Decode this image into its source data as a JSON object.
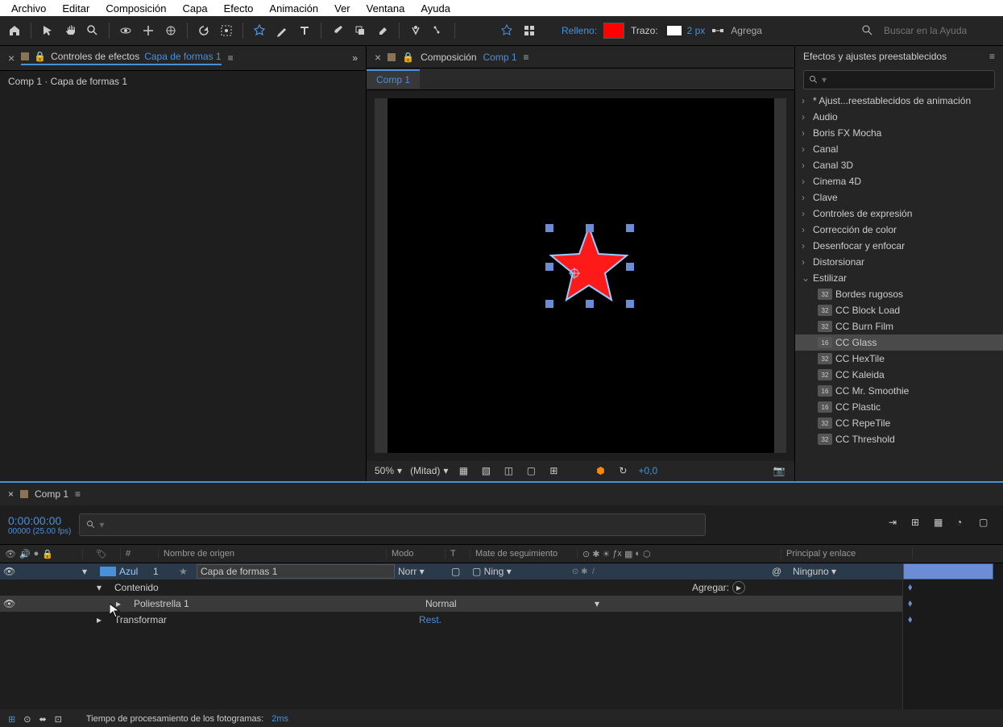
{
  "menu": {
    "items": [
      "Archivo",
      "Editar",
      "Composición",
      "Capa",
      "Efecto",
      "Animación",
      "Ver",
      "Ventana",
      "Ayuda"
    ]
  },
  "toolbar": {
    "fill_label": "Relleno:",
    "stroke_label": "Trazo:",
    "stroke_px": "2 px",
    "add_label": "Agrega",
    "help_placeholder": "Buscar en la Ayuda"
  },
  "left_panel": {
    "title": "Controles de efectos",
    "layer": "Capa de formas 1",
    "breadcrumb": "Comp 1 · Capa de formas 1"
  },
  "center_panel": {
    "title": "Composición",
    "comp": "Comp 1",
    "tab": "Comp 1"
  },
  "viewer_controls": {
    "zoom": "50%",
    "res": "(Mitad)",
    "offset": "+0,0"
  },
  "right_panel": {
    "title": "Efectos y ajustes preestablecidos",
    "tree": [
      {
        "label": "* Ajust...reestablecidos de animación",
        "open": false,
        "lvl": 0
      },
      {
        "label": "Audio",
        "open": false,
        "lvl": 0
      },
      {
        "label": "Boris FX Mocha",
        "open": false,
        "lvl": 0
      },
      {
        "label": "Canal",
        "open": false,
        "lvl": 0
      },
      {
        "label": "Canal 3D",
        "open": false,
        "lvl": 0
      },
      {
        "label": "Cinema 4D",
        "open": false,
        "lvl": 0
      },
      {
        "label": "Clave",
        "open": false,
        "lvl": 0
      },
      {
        "label": "Controles de expresión",
        "open": false,
        "lvl": 0
      },
      {
        "label": "Corrección de color",
        "open": false,
        "lvl": 0
      },
      {
        "label": "Desenfocar y enfocar",
        "open": false,
        "lvl": 0
      },
      {
        "label": "Distorsionar",
        "open": false,
        "lvl": 0
      },
      {
        "label": "Estilizar",
        "open": true,
        "lvl": 0
      },
      {
        "label": "Bordes rugosos",
        "lvl": 1,
        "badge": "32"
      },
      {
        "label": "CC Block Load",
        "lvl": 1,
        "badge": "32"
      },
      {
        "label": "CC Burn Film",
        "lvl": 1,
        "badge": "32"
      },
      {
        "label": "CC Glass",
        "lvl": 1,
        "badge": "16",
        "sel": true
      },
      {
        "label": "CC HexTile",
        "lvl": 1,
        "badge": "32"
      },
      {
        "label": "CC Kaleida",
        "lvl": 1,
        "badge": "32"
      },
      {
        "label": "CC Mr. Smoothie",
        "lvl": 1,
        "badge": "16"
      },
      {
        "label": "CC Plastic",
        "lvl": 1,
        "badge": "16"
      },
      {
        "label": "CC RepeTile",
        "lvl": 1,
        "badge": "32"
      },
      {
        "label": "CC Threshold",
        "lvl": 1,
        "badge": "32"
      }
    ]
  },
  "timeline": {
    "tab": "Comp 1",
    "time": "0:00:00:00",
    "fps": "00000 (25.00 fps)",
    "cols": {
      "num": "#",
      "source": "Nombre de origen",
      "mode": "Modo",
      "t": "T",
      "track": "Mate de seguimiento",
      "parent": "Principal y enlace"
    },
    "layer": {
      "color": "Azul",
      "num": "1",
      "name": "Capa de formas 1",
      "mode": "Norr",
      "track": "Ning",
      "parent": "Ninguno"
    },
    "props": {
      "contents": "Contenido",
      "add": "Agregar:",
      "poly": "Poliestrella 1",
      "poly_mode": "Normal",
      "transform": "Transformar",
      "reset": "Rest."
    },
    "footer": {
      "label": "Tiempo de procesamiento de los fotogramas:",
      "value": "2ms"
    }
  }
}
